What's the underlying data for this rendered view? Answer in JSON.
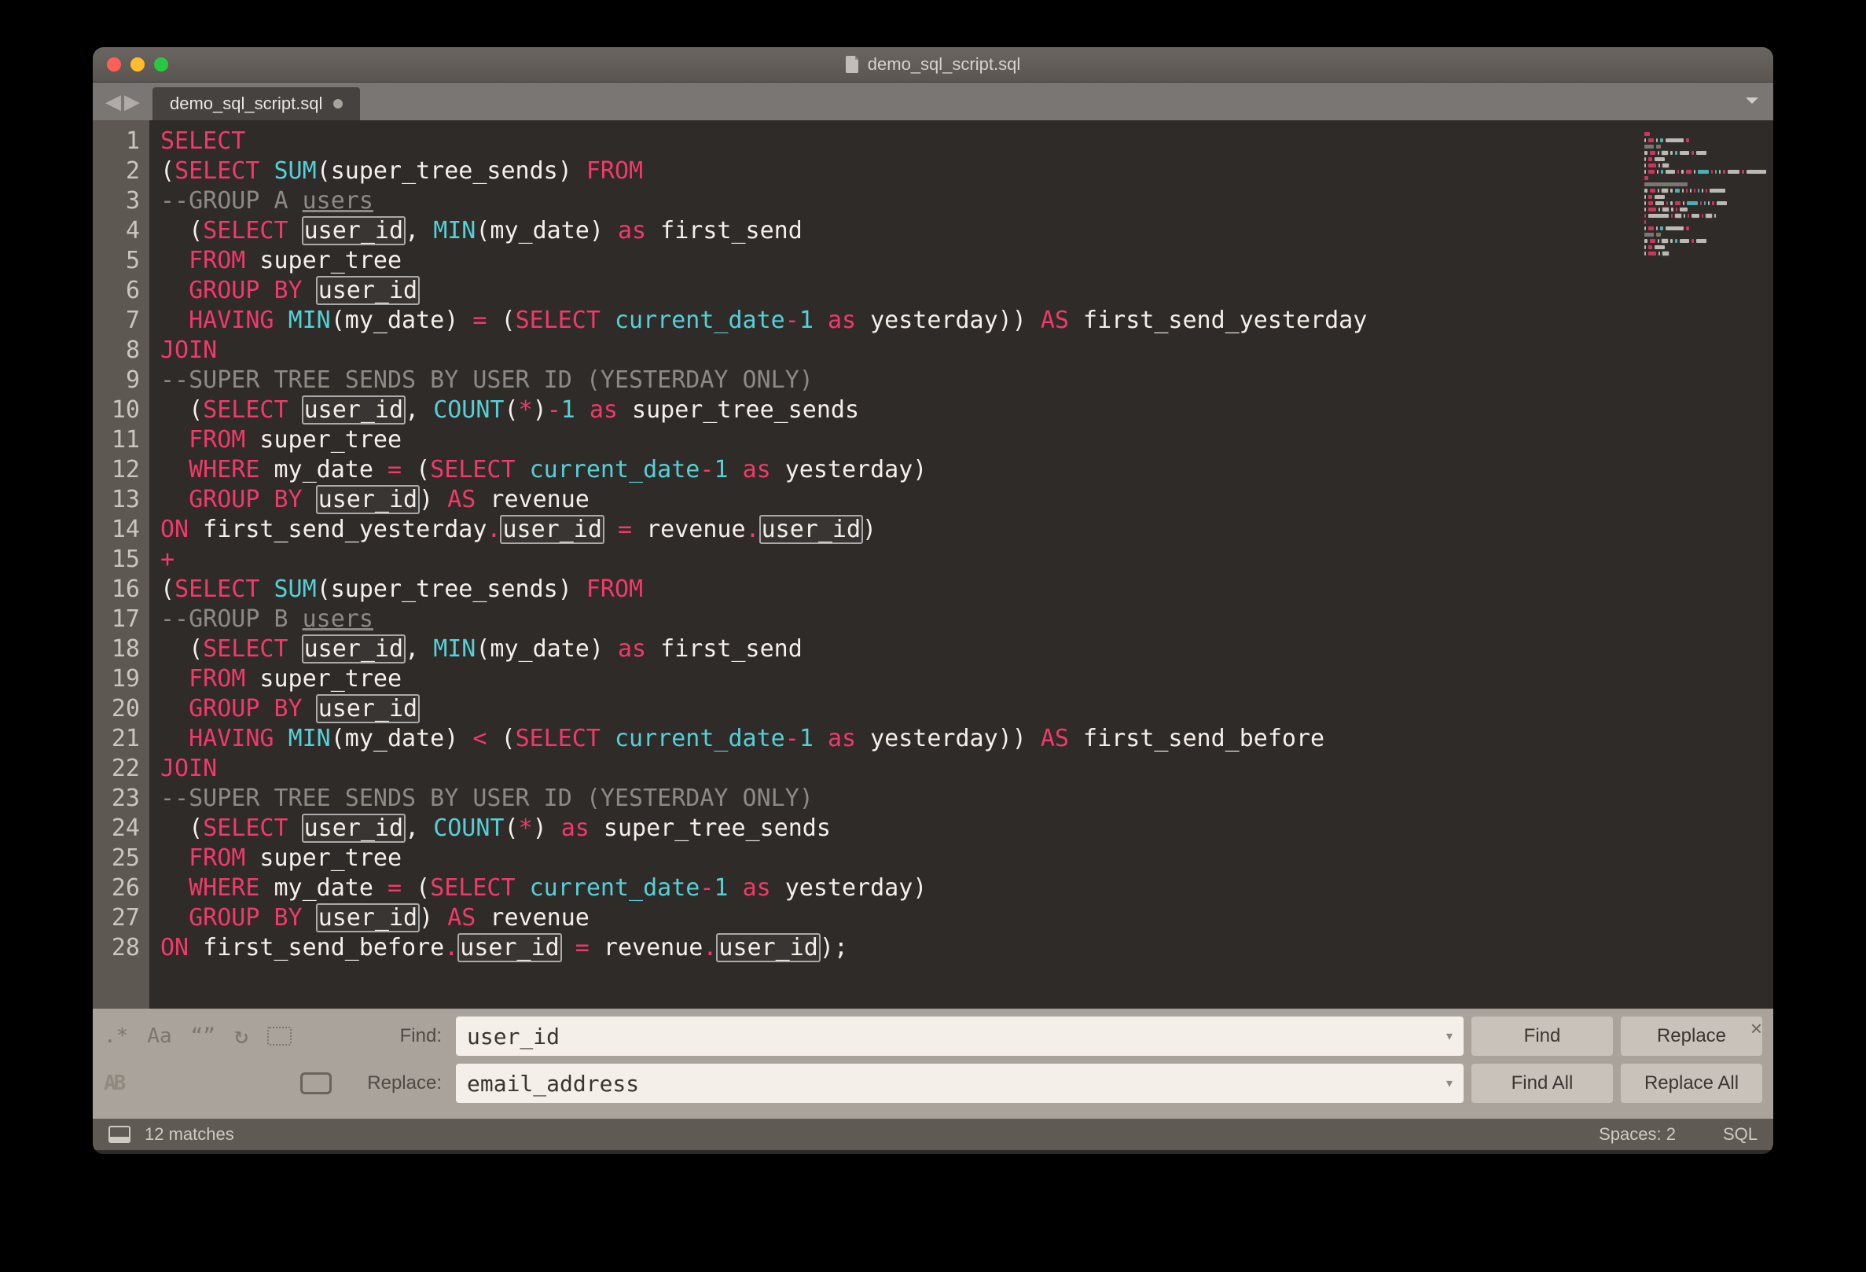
{
  "window": {
    "title": "demo_sql_script.sql"
  },
  "tabs": {
    "active": {
      "label": "demo_sql_script.sql",
      "modified": true
    }
  },
  "code": {
    "lines": [
      [
        {
          "t": "SELECT",
          "c": "kw"
        }
      ],
      [
        {
          "t": "(",
          "c": "fg"
        },
        {
          "t": "SELECT",
          "c": "kw"
        },
        {
          "t": " ",
          "c": "fg"
        },
        {
          "t": "SUM",
          "c": "fn"
        },
        {
          "t": "(super_tree_sends) ",
          "c": "fg"
        },
        {
          "t": "FROM",
          "c": "kw"
        }
      ],
      [
        {
          "t": "--GROUP A ",
          "c": "cm"
        },
        {
          "t": "users",
          "c": "cm",
          "u": true
        }
      ],
      [
        {
          "t": "  (",
          "c": "fg"
        },
        {
          "t": "SELECT",
          "c": "kw"
        },
        {
          "t": " ",
          "c": "fg"
        },
        {
          "t": "user_id",
          "c": "fg",
          "hl": true
        },
        {
          "t": ", ",
          "c": "fg"
        },
        {
          "t": "MIN",
          "c": "fn"
        },
        {
          "t": "(my_date) ",
          "c": "fg"
        },
        {
          "t": "as",
          "c": "kw"
        },
        {
          "t": " first_send",
          "c": "fg"
        }
      ],
      [
        {
          "t": "  ",
          "c": "fg"
        },
        {
          "t": "FROM",
          "c": "kw"
        },
        {
          "t": " super_tree",
          "c": "fg"
        }
      ],
      [
        {
          "t": "  ",
          "c": "fg"
        },
        {
          "t": "GROUP BY",
          "c": "kw"
        },
        {
          "t": " ",
          "c": "fg"
        },
        {
          "t": "user_id",
          "c": "fg",
          "hl": true
        }
      ],
      [
        {
          "t": "  ",
          "c": "fg"
        },
        {
          "t": "HAVING",
          "c": "kw"
        },
        {
          "t": " ",
          "c": "fg"
        },
        {
          "t": "MIN",
          "c": "fn"
        },
        {
          "t": "(my_date) ",
          "c": "fg"
        },
        {
          "t": "=",
          "c": "kw"
        },
        {
          "t": " (",
          "c": "fg"
        },
        {
          "t": "SELECT",
          "c": "kw"
        },
        {
          "t": " ",
          "c": "fg"
        },
        {
          "t": "current_date",
          "c": "fn"
        },
        {
          "t": "-",
          "c": "kw"
        },
        {
          "t": "1",
          "c": "fn"
        },
        {
          "t": " ",
          "c": "fg"
        },
        {
          "t": "as",
          "c": "kw"
        },
        {
          "t": " yesterday)) ",
          "c": "fg"
        },
        {
          "t": "AS",
          "c": "kw"
        },
        {
          "t": " first_send_yesterday",
          "c": "fg"
        }
      ],
      [
        {
          "t": "JOIN",
          "c": "kw"
        }
      ],
      [
        {
          "t": "--SUPER TREE SENDS BY USER ID (YESTERDAY ONLY)",
          "c": "cm"
        }
      ],
      [
        {
          "t": "  (",
          "c": "fg"
        },
        {
          "t": "SELECT",
          "c": "kw"
        },
        {
          "t": " ",
          "c": "fg"
        },
        {
          "t": "user_id",
          "c": "fg",
          "hl": true
        },
        {
          "t": ", ",
          "c": "fg"
        },
        {
          "t": "COUNT",
          "c": "fn"
        },
        {
          "t": "(",
          "c": "fg"
        },
        {
          "t": "*",
          "c": "kw"
        },
        {
          "t": ")",
          "c": "fg"
        },
        {
          "t": "-",
          "c": "kw"
        },
        {
          "t": "1",
          "c": "fn"
        },
        {
          "t": " ",
          "c": "fg"
        },
        {
          "t": "as",
          "c": "kw"
        },
        {
          "t": " super_tree_sends",
          "c": "fg"
        }
      ],
      [
        {
          "t": "  ",
          "c": "fg"
        },
        {
          "t": "FROM",
          "c": "kw"
        },
        {
          "t": " super_tree",
          "c": "fg"
        }
      ],
      [
        {
          "t": "  ",
          "c": "fg"
        },
        {
          "t": "WHERE",
          "c": "kw"
        },
        {
          "t": " my_date ",
          "c": "fg"
        },
        {
          "t": "=",
          "c": "kw"
        },
        {
          "t": " (",
          "c": "fg"
        },
        {
          "t": "SELECT",
          "c": "kw"
        },
        {
          "t": " ",
          "c": "fg"
        },
        {
          "t": "current_date",
          "c": "fn"
        },
        {
          "t": "-",
          "c": "kw"
        },
        {
          "t": "1",
          "c": "fn"
        },
        {
          "t": " ",
          "c": "fg"
        },
        {
          "t": "as",
          "c": "kw"
        },
        {
          "t": " yesterday)",
          "c": "fg"
        }
      ],
      [
        {
          "t": "  ",
          "c": "fg"
        },
        {
          "t": "GROUP BY",
          "c": "kw"
        },
        {
          "t": " ",
          "c": "fg"
        },
        {
          "t": "user_id",
          "c": "fg",
          "hl": true
        },
        {
          "t": ") ",
          "c": "fg"
        },
        {
          "t": "AS",
          "c": "kw"
        },
        {
          "t": " revenue",
          "c": "fg"
        }
      ],
      [
        {
          "t": "ON",
          "c": "kw"
        },
        {
          "t": " first_send_yesterday",
          "c": "fg"
        },
        {
          "t": ".",
          "c": "kw"
        },
        {
          "t": "user_id",
          "c": "fg",
          "hl": true
        },
        {
          "t": " ",
          "c": "fg"
        },
        {
          "t": "=",
          "c": "kw"
        },
        {
          "t": " revenue",
          "c": "fg"
        },
        {
          "t": ".",
          "c": "kw"
        },
        {
          "t": "user_id",
          "c": "fg",
          "hl": true
        },
        {
          "t": ")",
          "c": "fg"
        }
      ],
      [
        {
          "t": "+",
          "c": "kw"
        }
      ],
      [
        {
          "t": "(",
          "c": "fg"
        },
        {
          "t": "SELECT",
          "c": "kw"
        },
        {
          "t": " ",
          "c": "fg"
        },
        {
          "t": "SUM",
          "c": "fn"
        },
        {
          "t": "(super_tree_sends) ",
          "c": "fg"
        },
        {
          "t": "FROM",
          "c": "kw"
        }
      ],
      [
        {
          "t": "--GROUP B ",
          "c": "cm"
        },
        {
          "t": "users",
          "c": "cm",
          "u": true
        }
      ],
      [
        {
          "t": "  (",
          "c": "fg"
        },
        {
          "t": "SELECT",
          "c": "kw"
        },
        {
          "t": " ",
          "c": "fg"
        },
        {
          "t": "user_id",
          "c": "fg",
          "hl": true
        },
        {
          "t": ", ",
          "c": "fg"
        },
        {
          "t": "MIN",
          "c": "fn"
        },
        {
          "t": "(my_date) ",
          "c": "fg"
        },
        {
          "t": "as",
          "c": "kw"
        },
        {
          "t": " first_send",
          "c": "fg"
        }
      ],
      [
        {
          "t": "  ",
          "c": "fg"
        },
        {
          "t": "FROM",
          "c": "kw"
        },
        {
          "t": " super_tree",
          "c": "fg"
        }
      ],
      [
        {
          "t": "  ",
          "c": "fg"
        },
        {
          "t": "GROUP BY",
          "c": "kw"
        },
        {
          "t": " ",
          "c": "fg"
        },
        {
          "t": "user_id",
          "c": "fg",
          "hl": true
        }
      ],
      [
        {
          "t": "  ",
          "c": "fg"
        },
        {
          "t": "HAVING",
          "c": "kw"
        },
        {
          "t": " ",
          "c": "fg"
        },
        {
          "t": "MIN",
          "c": "fn"
        },
        {
          "t": "(my_date) ",
          "c": "fg"
        },
        {
          "t": "<",
          "c": "kw"
        },
        {
          "t": " (",
          "c": "fg"
        },
        {
          "t": "SELECT",
          "c": "kw"
        },
        {
          "t": " ",
          "c": "fg"
        },
        {
          "t": "current_date",
          "c": "fn"
        },
        {
          "t": "-",
          "c": "kw"
        },
        {
          "t": "1",
          "c": "fn"
        },
        {
          "t": " ",
          "c": "fg"
        },
        {
          "t": "as",
          "c": "kw"
        },
        {
          "t": " yesterday)) ",
          "c": "fg"
        },
        {
          "t": "AS",
          "c": "kw"
        },
        {
          "t": " first_send_before",
          "c": "fg"
        }
      ],
      [
        {
          "t": "JOIN",
          "c": "kw"
        }
      ],
      [
        {
          "t": "--SUPER TREE SENDS BY USER ID (YESTERDAY ONLY)",
          "c": "cm"
        }
      ],
      [
        {
          "t": "  (",
          "c": "fg"
        },
        {
          "t": "SELECT",
          "c": "kw"
        },
        {
          "t": " ",
          "c": "fg"
        },
        {
          "t": "user_id",
          "c": "fg",
          "hl": true
        },
        {
          "t": ", ",
          "c": "fg"
        },
        {
          "t": "COUNT",
          "c": "fn"
        },
        {
          "t": "(",
          "c": "fg"
        },
        {
          "t": "*",
          "c": "kw"
        },
        {
          "t": ") ",
          "c": "fg"
        },
        {
          "t": "as",
          "c": "kw"
        },
        {
          "t": " super_tree_sends",
          "c": "fg"
        }
      ],
      [
        {
          "t": "  ",
          "c": "fg"
        },
        {
          "t": "FROM",
          "c": "kw"
        },
        {
          "t": " super_tree",
          "c": "fg"
        }
      ],
      [
        {
          "t": "  ",
          "c": "fg"
        },
        {
          "t": "WHERE",
          "c": "kw"
        },
        {
          "t": " my_date ",
          "c": "fg"
        },
        {
          "t": "=",
          "c": "kw"
        },
        {
          "t": " (",
          "c": "fg"
        },
        {
          "t": "SELECT",
          "c": "kw"
        },
        {
          "t": " ",
          "c": "fg"
        },
        {
          "t": "current_date",
          "c": "fn"
        },
        {
          "t": "-",
          "c": "kw"
        },
        {
          "t": "1",
          "c": "fn"
        },
        {
          "t": " ",
          "c": "fg"
        },
        {
          "t": "as",
          "c": "kw"
        },
        {
          "t": " yesterday)",
          "c": "fg"
        }
      ],
      [
        {
          "t": "  ",
          "c": "fg"
        },
        {
          "t": "GROUP BY",
          "c": "kw"
        },
        {
          "t": " ",
          "c": "fg"
        },
        {
          "t": "user_id",
          "c": "fg",
          "hl": true
        },
        {
          "t": ") ",
          "c": "fg"
        },
        {
          "t": "AS",
          "c": "kw"
        },
        {
          "t": " revenue",
          "c": "fg"
        }
      ],
      [
        {
          "t": "ON",
          "c": "kw"
        },
        {
          "t": " first_send_before",
          "c": "fg"
        },
        {
          "t": ".",
          "c": "kw"
        },
        {
          "t": "user_id",
          "c": "fg",
          "hl": true
        },
        {
          "t": " ",
          "c": "fg"
        },
        {
          "t": "=",
          "c": "kw"
        },
        {
          "t": " revenue",
          "c": "fg"
        },
        {
          "t": ".",
          "c": "kw"
        },
        {
          "t": "user_id",
          "c": "fg",
          "hl": true
        },
        {
          "t": ");",
          "c": "fg"
        }
      ]
    ]
  },
  "find": {
    "find_label": "Find:",
    "replace_label": "Replace:",
    "find_value": "user_id",
    "replace_value": "email_address",
    "options": {
      "regex": ".*",
      "case": "Aa",
      "whole": "“”",
      "wrap": "⟳",
      "sel": "⊡",
      "preserve": "AB",
      "highlight": "▭"
    },
    "buttons": {
      "find": "Find",
      "replace": "Replace",
      "find_all": "Find All",
      "replace_all": "Replace All"
    }
  },
  "status": {
    "matches": "12 matches",
    "spaces": "Spaces: 2",
    "syntax": "SQL"
  }
}
